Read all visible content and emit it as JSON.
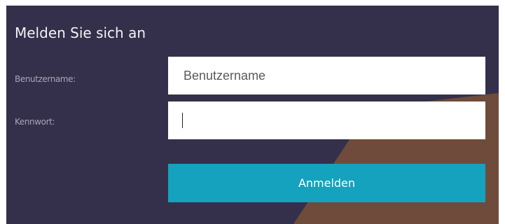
{
  "dialog": {
    "title": "Melden Sie sich an"
  },
  "form": {
    "username_label": "Benutzername:",
    "username_value": "Benutzername",
    "password_label": "Kennwort:",
    "password_value": "",
    "submit_label": "Anmelden"
  },
  "colors": {
    "panel_background": "#34304b",
    "decor_shape": "#6e4b3a",
    "button_background": "#14a2be",
    "button_text": "#ffffff",
    "label_text": "#a7a5b8",
    "title_text": "#f2f2f4"
  }
}
